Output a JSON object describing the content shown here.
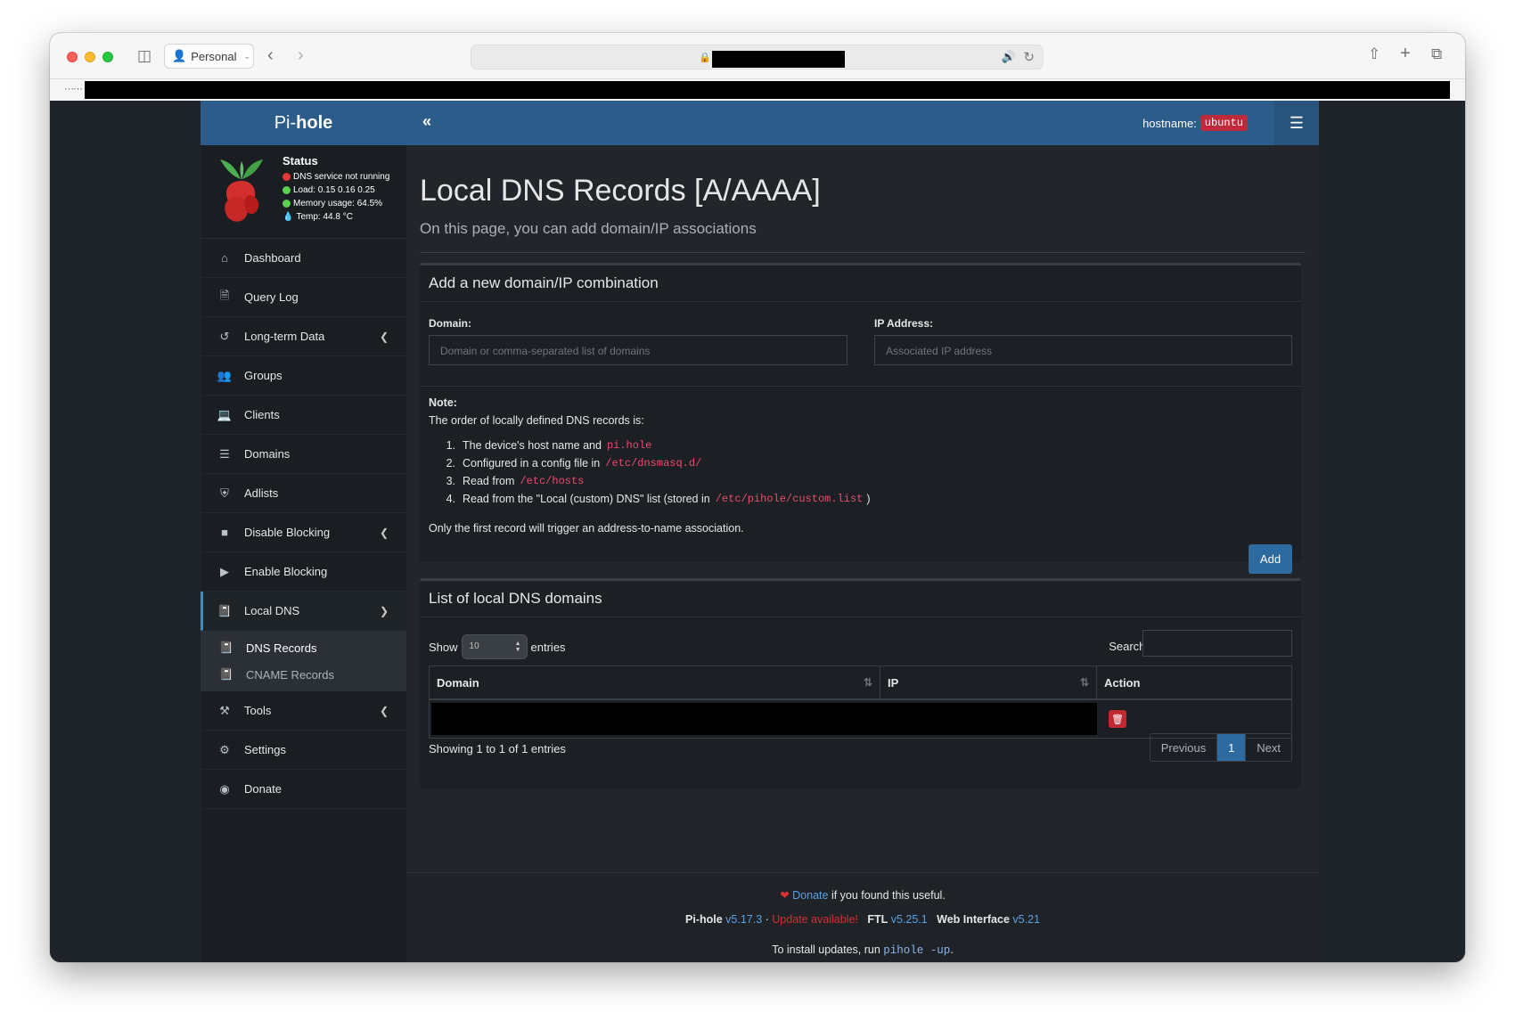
{
  "browser": {
    "profile": "Personal"
  },
  "brand": {
    "light": "Pi-",
    "bold": "hole"
  },
  "status": {
    "title": "Status",
    "dns": "DNS service not running",
    "load": "Load:  0.15  0.16  0.25",
    "memory": "Memory usage:  64.5%",
    "temp": "Temp: 44.8 °C"
  },
  "header": {
    "hostname_label": "hostname:",
    "hostname_value": "ubuntu"
  },
  "sidebar": {
    "items": [
      {
        "label": "Dashboard"
      },
      {
        "label": "Query Log"
      },
      {
        "label": "Long-term Data"
      },
      {
        "label": "Groups"
      },
      {
        "label": "Clients"
      },
      {
        "label": "Domains"
      },
      {
        "label": "Adlists"
      },
      {
        "label": "Disable Blocking"
      },
      {
        "label": "Enable Blocking"
      },
      {
        "label": "Local DNS"
      },
      {
        "label": "Tools"
      },
      {
        "label": "Settings"
      },
      {
        "label": "Donate"
      }
    ],
    "sub": [
      {
        "label": "DNS Records"
      },
      {
        "label": "CNAME Records"
      }
    ]
  },
  "page": {
    "title": "Local DNS Records [A/AAAA]",
    "subtitle": "On this page, you can add domain/IP associations"
  },
  "add_box": {
    "title": "Add a new domain/IP combination",
    "domain_label": "Domain:",
    "domain_placeholder": "Domain or comma-separated list of domains",
    "ip_label": "IP Address:",
    "ip_placeholder": "Associated IP address",
    "note_title": "Note:",
    "note_intro": "The order of locally defined DNS records is:",
    "list": [
      {
        "num": "1.",
        "text": "The device's host name and",
        "code": "pi.hole",
        "after": ""
      },
      {
        "num": "2.",
        "text": "Configured in a config file in",
        "code": "/etc/dnsmasq.d/",
        "after": ""
      },
      {
        "num": "3.",
        "text": "Read from",
        "code": "/etc/hosts",
        "after": ""
      },
      {
        "num": "4.",
        "text": "Read from the \"Local (custom) DNS\" list (stored in",
        "code": "/etc/pihole/custom.list",
        "after": ")"
      }
    ],
    "note_footer": "Only the first record will trigger an address-to-name association.",
    "add_label": "Add"
  },
  "list_box": {
    "title": "List of local DNS domains",
    "show_label": "Show",
    "show_value": "10",
    "entries_label": "entries",
    "search_label": "Search:",
    "columns": [
      "Domain",
      "IP",
      "Action"
    ],
    "info": "Showing 1 to 1 of 1 entries",
    "pagination": {
      "previous": "Previous",
      "current": "1",
      "next": "Next"
    }
  },
  "footer": {
    "donate_link": "Donate",
    "donate_text": "if you found this useful.",
    "pihole_label": "Pi-hole",
    "pihole_version": "v5.17.3",
    "update": "Update available!",
    "ftl_label": "FTL",
    "ftl_version": "v5.25.1",
    "web_label": "Web Interface",
    "web_version": "v5.21",
    "install_prefix": "To install updates, run",
    "install_cmd": "pihole -up",
    "install_suffix": "."
  }
}
